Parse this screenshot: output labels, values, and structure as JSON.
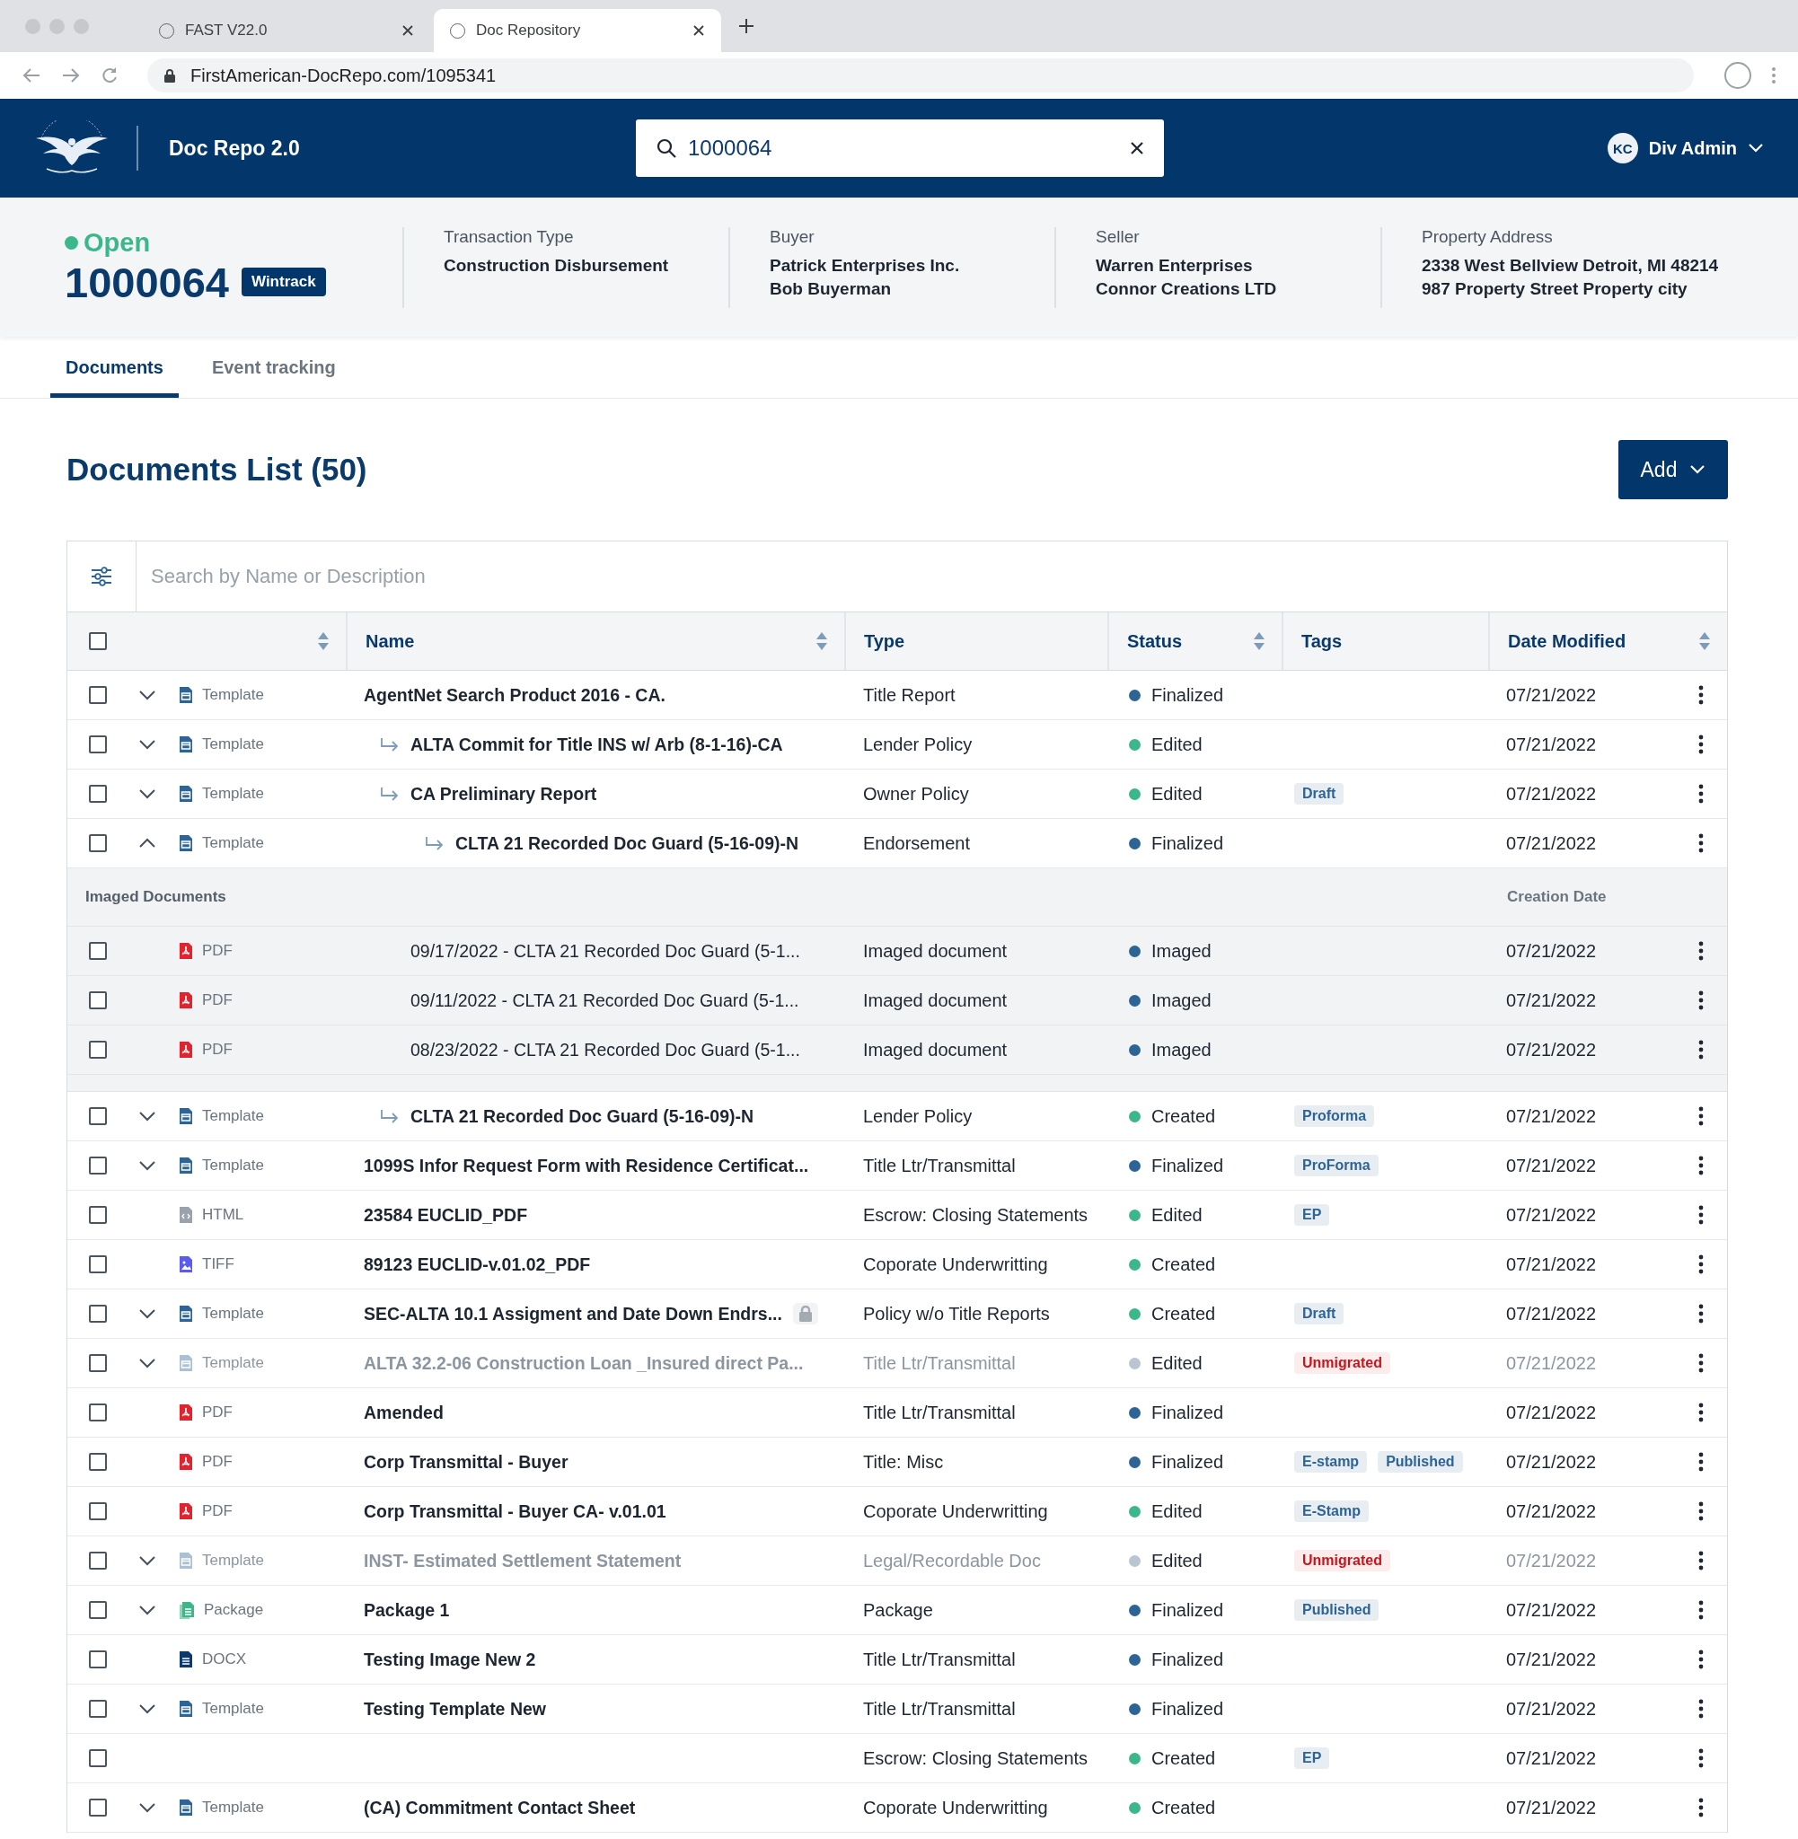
{
  "browser": {
    "tabs": [
      {
        "title": "FAST V22.0",
        "selected": false
      },
      {
        "title": "Doc Repository",
        "selected": true
      }
    ],
    "url": "FirstAmerican-DocRepo.com/1095341"
  },
  "header": {
    "app_title": "Doc Repo 2.0",
    "search": {
      "value": "1000064"
    },
    "user": {
      "initials": "KC",
      "name": "Div Admin"
    }
  },
  "summary": {
    "status": "Open",
    "file_number": "1000064",
    "badge": "Wintrack",
    "fields": [
      {
        "label": "Transaction Type",
        "lines": [
          "Construction Disbursement"
        ]
      },
      {
        "label": "Buyer",
        "lines": [
          "Patrick Enterprises Inc.",
          "Bob Buyerman"
        ]
      },
      {
        "label": "Seller",
        "lines": [
          "Warren Enterprises",
          "Connor Creations LTD"
        ]
      },
      {
        "label": "Property Address",
        "lines": [
          "2338 West Bellview Detroit, MI 48214",
          "987 Property Street Property city"
        ]
      }
    ]
  },
  "page_tabs": [
    {
      "label": "Documents",
      "selected": true
    },
    {
      "label": "Event tracking",
      "selected": false
    }
  ],
  "documents": {
    "title": "Documents List (50)",
    "add_button": "Add",
    "search": {
      "placeholder": "Search by Name or Description"
    }
  },
  "table": {
    "select_all": {
      "checked": false
    },
    "columns": [
      {
        "sortable": true
      },
      {
        "label": "Name",
        "sortable": true
      },
      {
        "label": "Type",
        "sortable": false
      },
      {
        "label": "Status",
        "sortable": true
      },
      {
        "label": "Tags",
        "sortable": false
      },
      {
        "label": "Date Modified",
        "sortable": true
      }
    ],
    "rows": [
      {
        "checked": false,
        "expanded": false,
        "format": {
          "label": "Template",
          "kind": "template"
        },
        "name": "AgentNet Search Product 2016 - CA.",
        "type": "Title Report",
        "status": {
          "label": "Finalized",
          "color": "#2d6496"
        },
        "date": "07/21/2022",
        "disabled": false,
        "children": [
          {
            "checked": false,
            "expanded": false,
            "format": {
              "label": "Template",
              "kind": "template"
            },
            "name": "ALTA Commit for Title INS w/ Arb (8-1-16)-CA",
            "type": "Lender Policy",
            "status": {
              "label": "Edited",
              "color": "#3bb78a"
            },
            "date": "07/21/2022",
            "disabled": false
          },
          {
            "checked": false,
            "expanded": false,
            "format": {
              "label": "Template",
              "kind": "template"
            },
            "name": "CA Preliminary Report",
            "type": "Owner Policy",
            "status": {
              "label": "Edited",
              "color": "#3bb78a"
            },
            "tags": [
              {
                "label": "Draft",
                "kind": "default"
              }
            ],
            "date": "07/21/2022",
            "disabled": false,
            "children": [
              {
                "checked": false,
                "expanded": true,
                "format": {
                  "label": "Template",
                  "kind": "template"
                },
                "name": "CLTA 21 Recorded Doc Guard (5-16-09)-N",
                "type": "Endorsement",
                "status": {
                  "label": "Finalized",
                  "color": "#2d6496"
                },
                "date": "07/21/2022",
                "disabled": false,
                "imaged_documents": {
                  "label": "Imaged Documents",
                  "date_label": "Creation Date",
                  "rows": [
                    {
                      "checked": false,
                      "format": {
                        "label": "PDF",
                        "kind": "pdf"
                      },
                      "name": "09/17/2022 - CLTA 21 Recorded Doc Guard (5-1...",
                      "type": "Imaged document",
                      "status": {
                        "label": "Imaged",
                        "color": "#2d6496"
                      },
                      "date": "07/21/2022"
                    },
                    {
                      "checked": false,
                      "format": {
                        "label": "PDF",
                        "kind": "pdf"
                      },
                      "name": "09/11/2022 - CLTA 21 Recorded Doc Guard (5-1...",
                      "type": "Imaged document",
                      "status": {
                        "label": "Imaged",
                        "color": "#2d6496"
                      },
                      "date": "07/21/2022"
                    },
                    {
                      "checked": false,
                      "format": {
                        "label": "PDF",
                        "kind": "pdf"
                      },
                      "name": "08/23/2022 - CLTA 21 Recorded Doc Guard (5-1...",
                      "type": "Imaged document",
                      "status": {
                        "label": "Imaged",
                        "color": "#2d6496"
                      },
                      "date": "07/21/2022"
                    }
                  ]
                }
              }
            ]
          },
          {
            "checked": false,
            "expanded": false,
            "format": {
              "label": "Template",
              "kind": "template"
            },
            "name": "CLTA 21 Recorded Doc Guard (5-16-09)-N",
            "type": "Lender Policy",
            "status": {
              "label": "Created",
              "color": "#3bb78a"
            },
            "tags": [
              {
                "label": "Proforma",
                "kind": "default"
              }
            ],
            "date": "07/21/2022",
            "disabled": false
          }
        ]
      },
      {
        "checked": false,
        "expanded": false,
        "format": {
          "label": "Template",
          "kind": "template"
        },
        "name": "1099S Infor Request Form with Residence Certificat...",
        "type": "Title Ltr/Transmittal",
        "status": {
          "label": "Finalized",
          "color": "#2d6496"
        },
        "tags": [
          {
            "label": "ProForma",
            "kind": "default"
          }
        ],
        "date": "07/21/2022",
        "disabled": false
      },
      {
        "checked": false,
        "format": {
          "label": "HTML",
          "kind": "html"
        },
        "name": "23584 EUCLID_PDF",
        "type": "Escrow: Closing Statements",
        "status": {
          "label": "Edited",
          "color": "#3bb78a"
        },
        "tags": [
          {
            "label": "EP",
            "kind": "default"
          }
        ],
        "date": "07/21/2022",
        "disabled": false
      },
      {
        "checked": false,
        "format": {
          "label": "TIFF",
          "kind": "tiff"
        },
        "name": "89123 EUCLID-v.01.02_PDF",
        "type": "Coporate Underwritting",
        "status": {
          "label": "Created",
          "color": "#3bb78a"
        },
        "date": "07/21/2022",
        "disabled": false
      },
      {
        "checked": false,
        "expanded": false,
        "format": {
          "label": "Template",
          "kind": "template"
        },
        "name": "SEC-ALTA 10.1 Assigment and Date Down Endrs...",
        "locked": true,
        "type": "Policy w/o Title Reports",
        "status": {
          "label": "Created",
          "color": "#3bb78a"
        },
        "tags": [
          {
            "label": "Draft",
            "kind": "default"
          }
        ],
        "date": "07/21/2022",
        "disabled": false
      },
      {
        "checked": false,
        "expanded": false,
        "format": {
          "label": "Template",
          "kind": "template"
        },
        "name": "ALTA 32.2-06 Construction Loan _Insured direct Pa...",
        "type": "Title Ltr/Transmittal",
        "status": {
          "label": "Edited",
          "color": "#b9c6d1"
        },
        "tags": [
          {
            "label": "Unmigrated",
            "kind": "alert"
          }
        ],
        "date": "07/21/2022",
        "disabled": true
      },
      {
        "checked": false,
        "format": {
          "label": "PDF",
          "kind": "pdf"
        },
        "name": "Amended",
        "type": "Title Ltr/Transmittal",
        "status": {
          "label": "Finalized",
          "color": "#2d6496"
        },
        "date": "07/21/2022",
        "disabled": false
      },
      {
        "checked": false,
        "format": {
          "label": "PDF",
          "kind": "pdf"
        },
        "name": "Corp Transmittal - Buyer",
        "type": "Title: Misc",
        "status": {
          "label": "Finalized",
          "color": "#2d6496"
        },
        "tags": [
          {
            "label": "E-stamp",
            "kind": "default"
          },
          {
            "label": "Published",
            "kind": "default"
          }
        ],
        "date": "07/21/2022",
        "disabled": false
      },
      {
        "checked": false,
        "format": {
          "label": "PDF",
          "kind": "pdf"
        },
        "name": "Corp Transmittal - Buyer CA- v.01.01",
        "type": "Coporate Underwritting",
        "status": {
          "label": "Edited",
          "color": "#3bb78a"
        },
        "tags": [
          {
            "label": "E-Stamp",
            "kind": "default"
          }
        ],
        "date": "07/21/2022",
        "disabled": false
      },
      {
        "checked": false,
        "expanded": false,
        "format": {
          "label": "Template",
          "kind": "template"
        },
        "name": "INST- Estimated Settlement Statement",
        "type": "Legal/Recordable Doc",
        "status": {
          "label": "Edited",
          "color": "#b9c6d1"
        },
        "tags": [
          {
            "label": "Unmigrated",
            "kind": "alert"
          }
        ],
        "date": "07/21/2022",
        "disabled": true
      },
      {
        "checked": false,
        "expanded": false,
        "format": {
          "label": "Package",
          "kind": "package"
        },
        "name": "Package 1",
        "type": "Package",
        "status": {
          "label": "Finalized",
          "color": "#2d6496"
        },
        "tags": [
          {
            "label": "Published",
            "kind": "default"
          }
        ],
        "date": "07/21/2022",
        "disabled": false
      },
      {
        "checked": false,
        "format": {
          "label": "DOCX",
          "kind": "docx"
        },
        "name": "Testing Image New 2",
        "type": "Title Ltr/Transmittal",
        "status": {
          "label": "Finalized",
          "color": "#2d6496"
        },
        "date": "07/21/2022",
        "disabled": false
      },
      {
        "checked": false,
        "expanded": false,
        "format": {
          "label": "Template",
          "kind": "template"
        },
        "name": "Testing Template New",
        "type": "Title Ltr/Transmittal",
        "status": {
          "label": "Finalized",
          "color": "#2d6496"
        },
        "date": "07/21/2022",
        "disabled": false
      },
      {
        "checked": false,
        "type": "Escrow: Closing Statements",
        "status": {
          "label": "Created",
          "color": "#3bb78a"
        },
        "tags": [
          {
            "label": "EP",
            "kind": "default"
          }
        ],
        "date": "07/21/2022",
        "disabled": false
      },
      {
        "checked": false,
        "expanded": false,
        "format": {
          "label": "Template",
          "kind": "template"
        },
        "name": "(CA) Commitment Contact Sheet",
        "type": "Coporate Underwritting",
        "status": {
          "label": "Created",
          "color": "#3bb78a"
        },
        "date": "07/21/2022",
        "disabled": false
      }
    ]
  }
}
